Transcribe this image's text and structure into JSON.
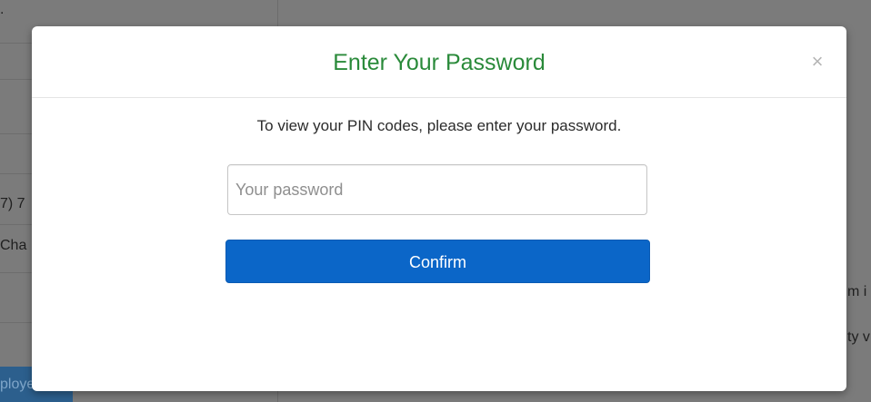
{
  "background": {
    "cell_texts": [
      ".",
      "7) 7",
      "Cha",
      "m i",
      "ty v"
    ],
    "employee_button_label": "ployee"
  },
  "modal": {
    "title": "Enter Your Password",
    "close_symbol": "×",
    "message": "To view your PIN codes, please enter your password.",
    "password_field": {
      "placeholder": "Your password",
      "value": ""
    },
    "confirm_label": "Confirm"
  }
}
